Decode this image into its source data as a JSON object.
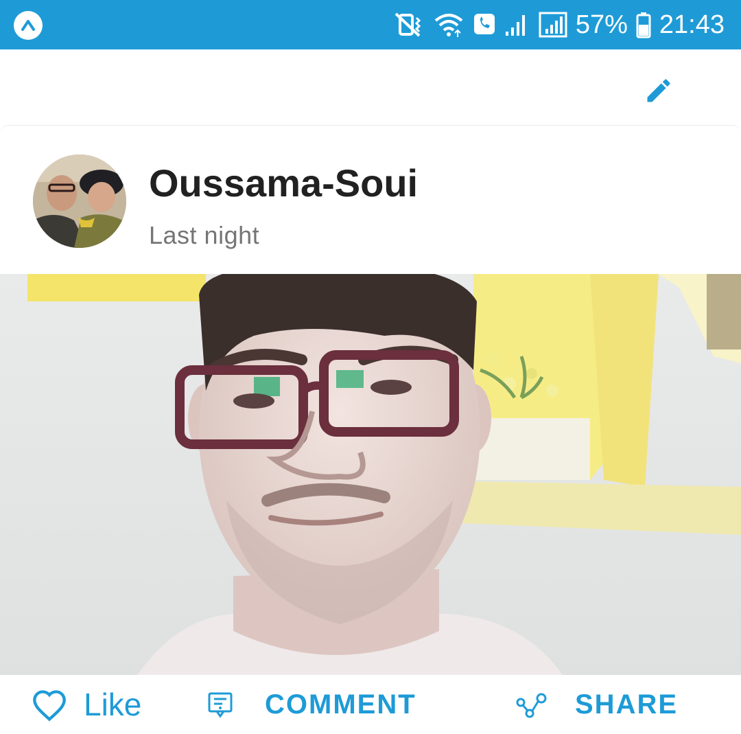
{
  "status_bar": {
    "battery": "57%",
    "time": "21:43",
    "icons": [
      "app-logo-icon",
      "vibrate-mute-icon",
      "wifi-icon",
      "wifi-calling-icon",
      "signal-bars-icon",
      "signal-bars-icon",
      "battery-icon"
    ],
    "background": "#1e9bd7"
  },
  "toolbar": {
    "edit_icon": "pencil-icon",
    "accent": "#1e9bd7"
  },
  "post": {
    "author": "Oussama-Soui",
    "time": "Last night",
    "avatar_icon": "profile-photo",
    "image": "selfie-photo"
  },
  "actions": {
    "like_label": "Like",
    "comment_label": "COMMENT",
    "share_label": "SHARE",
    "like_icon": "heart-outline-icon",
    "comment_icon": "comment-bubble-icon",
    "share_icon": "share-nodes-icon",
    "accent": "#1e9bd7"
  }
}
